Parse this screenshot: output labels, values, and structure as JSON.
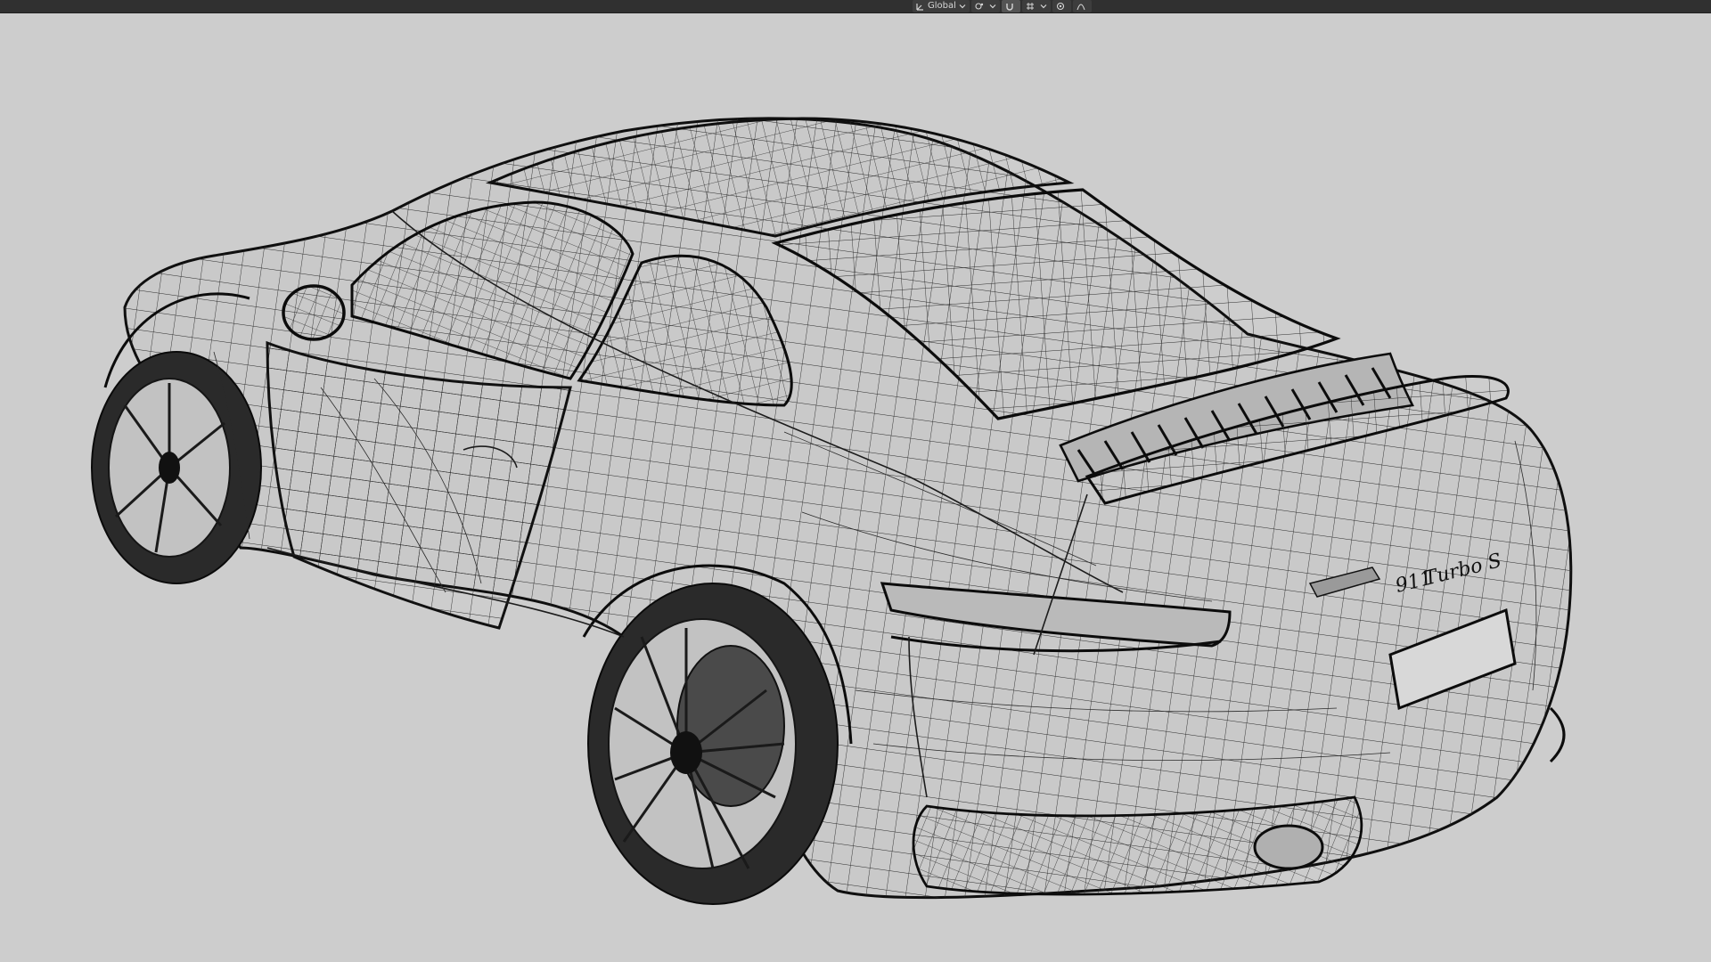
{
  "header": {
    "transform_orientation": {
      "label": "Global",
      "icon": "transform-orientation-icon"
    },
    "pivot": {
      "icon": "pivot-point-icon"
    },
    "snapping": {
      "icon": "snap-magnet-icon",
      "grid_icon": "snap-increment-icon"
    },
    "proportional": {
      "icon": "proportional-editing-icon",
      "falloff_icon": "falloff-curve-icon"
    }
  },
  "viewport": {
    "background_color": "#cdcdcd",
    "wire_color": "#1a1a1a",
    "badge": {
      "model_text": "911",
      "trim_text": "Turbo S"
    }
  }
}
